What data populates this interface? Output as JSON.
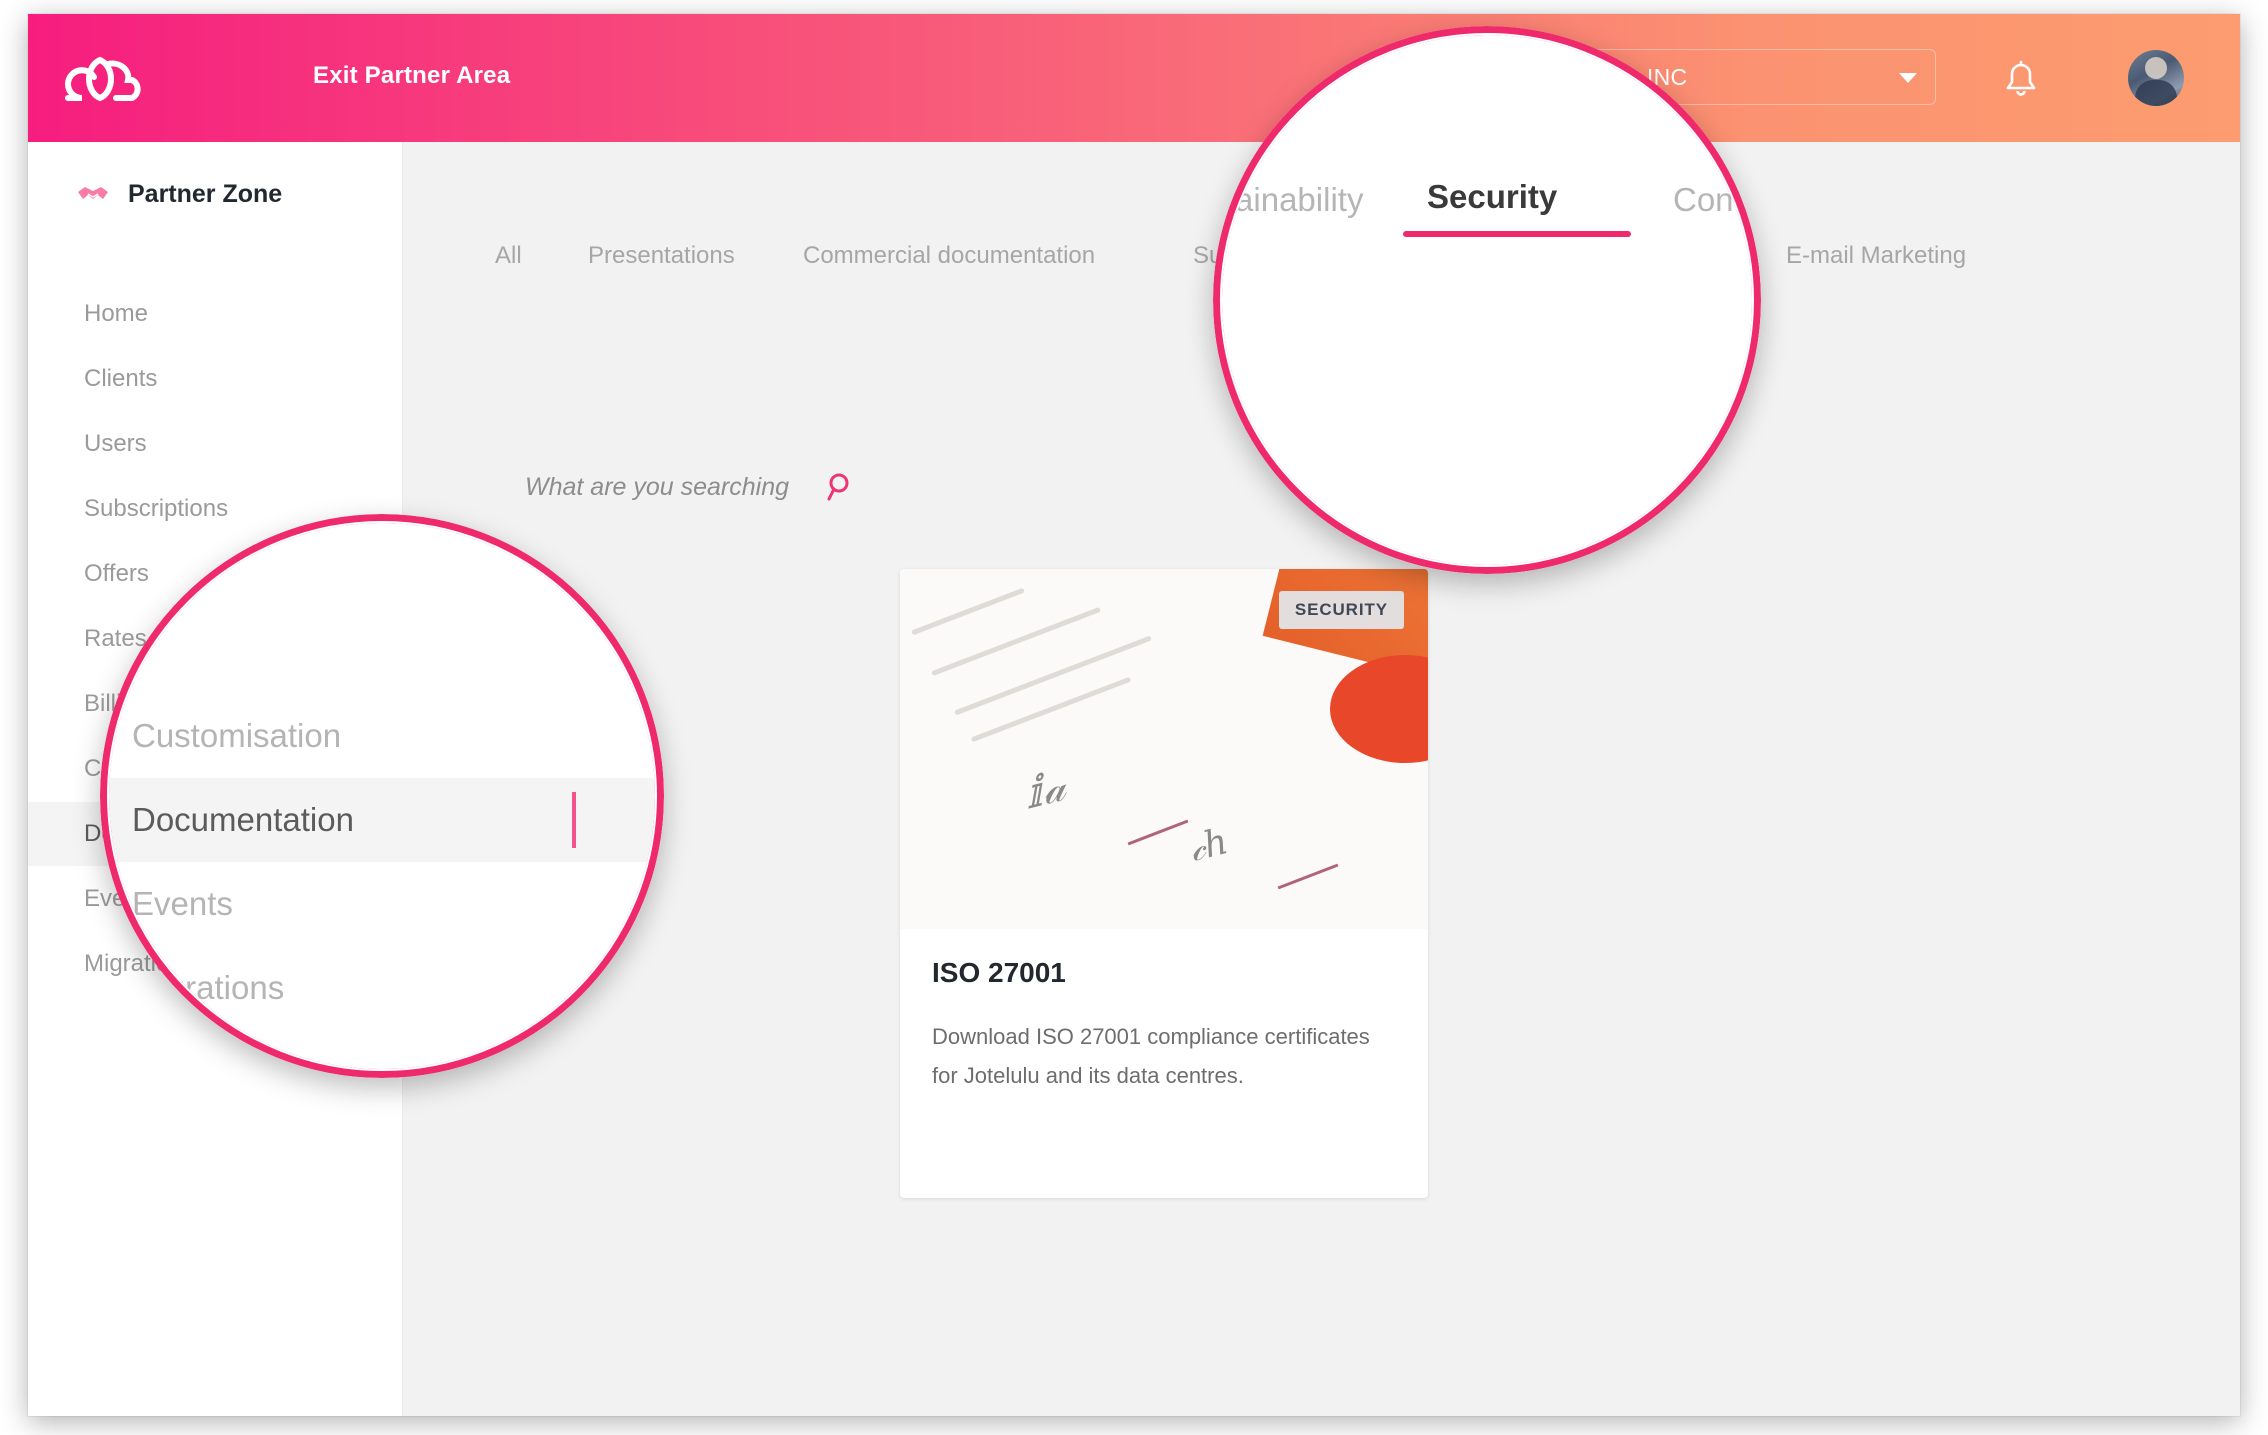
{
  "topbar": {
    "logo_icon": "cloud-logo-icon",
    "exit_label": "Exit Partner Area",
    "company": "DEMO INC",
    "caret_icon": "chevron-down-icon",
    "bell_icon": "bell-icon",
    "avatar_icon": "user-avatar",
    "gradient_from": "#F61D7F",
    "gradient_to": "#FC9C70"
  },
  "sidebar": {
    "brand_icon": "handshake-icon",
    "brand_label": "Partner Zone",
    "items": [
      {
        "label": "Home",
        "active": false
      },
      {
        "label": "Clients",
        "active": false
      },
      {
        "label": "Users",
        "active": false
      },
      {
        "label": "Subscriptions",
        "active": false
      },
      {
        "label": "Offers",
        "active": false
      },
      {
        "label": "Rates",
        "active": false
      },
      {
        "label": "Billing",
        "active": false
      },
      {
        "label": "Customisation",
        "active": false
      },
      {
        "label": "Documentation",
        "active": true
      },
      {
        "label": "Events",
        "active": false
      },
      {
        "label": "Migrations",
        "active": false
      }
    ]
  },
  "main": {
    "tabs": [
      {
        "label": "All",
        "active": false
      },
      {
        "label": "Presentations",
        "active": false
      },
      {
        "label": "Commercial documentation",
        "active": false
      },
      {
        "label": "Sustainability",
        "active": false
      },
      {
        "label": "Security",
        "active": true
      },
      {
        "label": "Contracts",
        "active": false
      },
      {
        "label": "E-mail Marketing",
        "active": false
      }
    ],
    "search": {
      "placeholder": "What are you searching",
      "icon": "search-icon"
    },
    "card": {
      "badge": "SECURITY",
      "title": "ISO 27001",
      "description": "Download ISO 27001 compliance certificates for Jotelulu and its data centres."
    }
  },
  "loupe_tabs": {
    "items": [
      {
        "label": "Sustainability",
        "active": false
      },
      {
        "label": "Security",
        "active": true
      },
      {
        "label": "Contracts",
        "active": false
      }
    ],
    "accent": "#EF2A6C"
  },
  "loupe_sidebar": {
    "items": [
      {
        "label": "Customisation",
        "active": false
      },
      {
        "label": "Documentation",
        "active": true
      },
      {
        "label": "Events",
        "active": false
      },
      {
        "label": "Migrations",
        "active": false
      }
    ],
    "accent": "#EF2A6C"
  }
}
